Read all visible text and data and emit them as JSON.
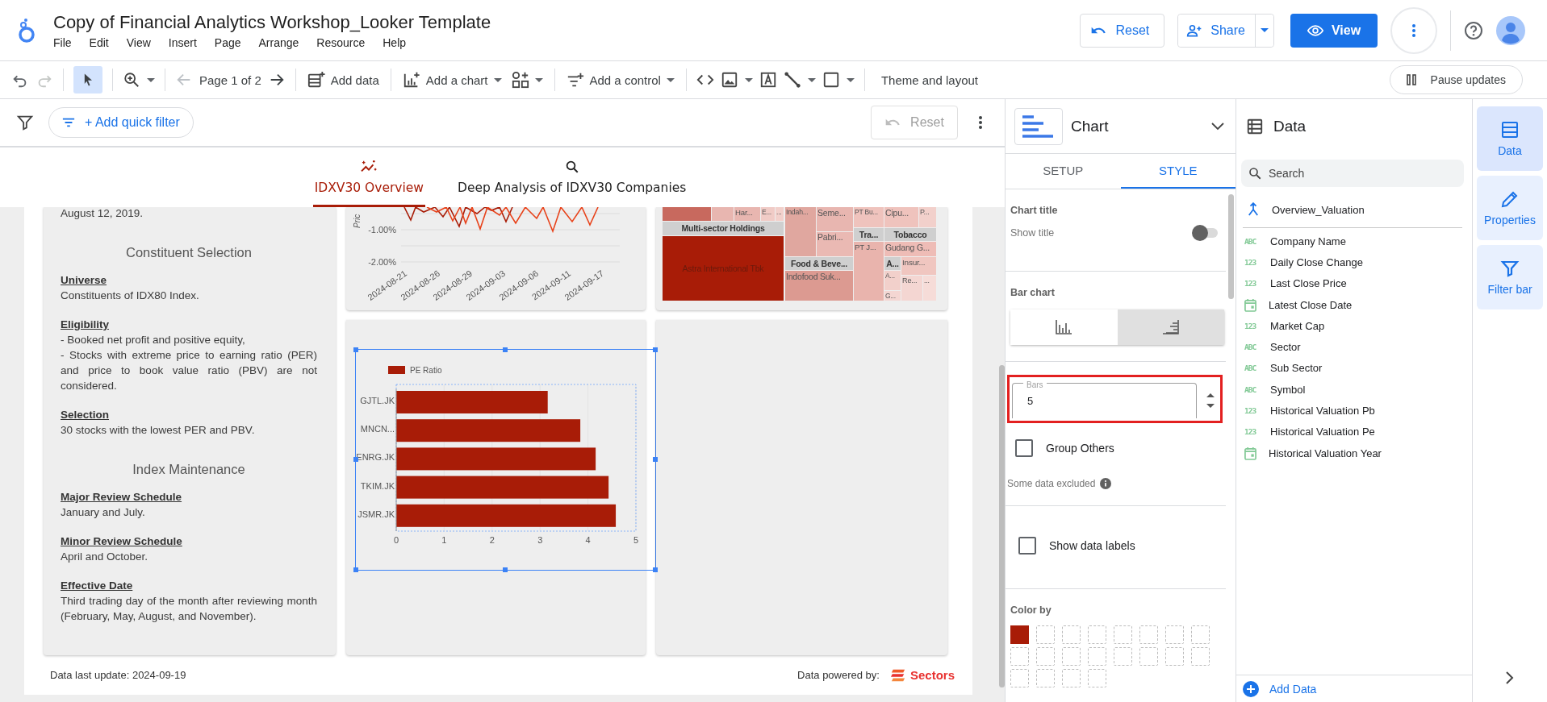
{
  "app": {
    "title": "Copy of Financial Analytics Workshop_Looker Template",
    "menu": [
      "File",
      "Edit",
      "View",
      "Insert",
      "Page",
      "Arrange",
      "Resource",
      "Help"
    ],
    "reset": "Reset",
    "share": "Share",
    "view": "View"
  },
  "toolbar": {
    "page_indicator": "Page 1 of 2",
    "add_data": "Add data",
    "add_chart": "Add a chart",
    "add_control": "Add a control",
    "theme": "Theme and layout",
    "pause": "Pause updates"
  },
  "filter_bar": {
    "add_filter": "+ Add quick filter",
    "reset": "Reset",
    "reset_disabled": true
  },
  "page_tabs": [
    {
      "label": "IDXV30 Overview",
      "selected": true
    },
    {
      "label": "Deep Analysis of IDXV30 Companies",
      "selected": false
    }
  ],
  "description_card": {
    "intro": "August 12, 2019.",
    "blocks": [
      {
        "kind": "heading",
        "text": "Constituent Selection"
      },
      {
        "kind": "item",
        "title": "Universe",
        "lines": [
          "Constituents of IDX80 Index."
        ]
      },
      {
        "kind": "item",
        "title": "Eligibility",
        "lines": [
          "- Booked net profit and positive equity,",
          "- Stocks with extreme price to earning ratio (PER) and price to book value ratio (PBV) are not considered."
        ]
      },
      {
        "kind": "item",
        "title": "Selection",
        "lines": [
          "30 stocks with the lowest PER and PBV."
        ]
      },
      {
        "kind": "heading",
        "text": "Index Maintenance"
      },
      {
        "kind": "item",
        "title": "Major Review Schedule",
        "lines": [
          "January and July."
        ]
      },
      {
        "kind": "item",
        "title": "Minor Review Schedule",
        "lines": [
          "April and October."
        ]
      },
      {
        "kind": "item",
        "title": "Effective Date",
        "lines": [
          "Third trading day of the month after reviewing month (February, May, August, and November)."
        ]
      }
    ]
  },
  "price_chart": {
    "y_axis_label": "Pric",
    "y_ticks": [
      "-1.00%",
      "-2.00%"
    ],
    "x_ticks": [
      "2024-08-21",
      "2024-08-26",
      "2024-08-29",
      "2024-09-03",
      "2024-09-06",
      "2024-09-11",
      "2024-09-17"
    ]
  },
  "treemap": {
    "cells": [
      {
        "kind": "cell",
        "color": "#c8695e"
      },
      {
        "kind": "cell",
        "color": "#e8b6b0"
      },
      {
        "kind": "cell",
        "label": "Har...",
        "color": "#e8b6b0"
      },
      {
        "kind": "cell",
        "label": "E...",
        "color": "#f0cbc6"
      },
      {
        "kind": "cell",
        "label": "...",
        "color": "#f2d0cb"
      },
      {
        "kind": "header",
        "label": "Multi-sector Holdings"
      },
      {
        "kind": "cell",
        "label": "Astra International Tbk",
        "color": "#a81c07"
      },
      {
        "kind": "cell",
        "label": "Indah...",
        "color": "#e0a79f"
      },
      {
        "kind": "cell",
        "label": "Seme...",
        "color": "#e8b6b0"
      },
      {
        "kind": "cell",
        "label": "Pabri...",
        "color": "#eab9b3"
      },
      {
        "kind": "header",
        "label": "Food & Beve..."
      },
      {
        "kind": "cell",
        "label": "Indofood Suk...",
        "color": "#dc9a91"
      },
      {
        "kind": "cell",
        "label": "PT Bu...",
        "color": "#efc3bd"
      },
      {
        "kind": "header",
        "label": "Tra..."
      },
      {
        "kind": "cell",
        "label": "PT J...",
        "color": "#e9b4ad"
      },
      {
        "kind": "cell",
        "label": "Cipu...",
        "color": "#efc3bd"
      },
      {
        "kind": "cell",
        "label": "P...",
        "color": "#f2d0cb"
      },
      {
        "kind": "header",
        "label": "Tobacco"
      },
      {
        "kind": "cell",
        "label": "Gudang G...",
        "color": "#eebcb6"
      },
      {
        "kind": "header",
        "label": "A..."
      },
      {
        "kind": "cell",
        "label": "A...",
        "color": "#f2d0cb"
      },
      {
        "kind": "cell",
        "label": "G...",
        "color": "#f4d6d2"
      },
      {
        "kind": "cell",
        "label": "Insur...",
        "color": "#f0c6c0"
      },
      {
        "kind": "cell",
        "label": "Re...",
        "color": "#f4d6d2"
      },
      {
        "kind": "cell",
        "label": "...",
        "color": "#f6dcd8"
      }
    ]
  },
  "pe_chart": {
    "chart_data": {
      "type": "bar",
      "orientation": "horizontal",
      "categories": [
        "GJTL.JK",
        "MNCN...",
        "ENRG.JK",
        "TKIM.JK",
        "JSMR.JK"
      ],
      "series": [
        {
          "name": "PE Ratio",
          "color": "#a81c07",
          "values": [
            3.16,
            3.84,
            4.16,
            4.43,
            4.58
          ]
        }
      ],
      "xlim": [
        0,
        5
      ],
      "xticks": [
        0,
        1,
        2,
        3,
        4,
        5
      ],
      "grid": true
    }
  },
  "footer": {
    "updated": "Data last update: 2024-09-19",
    "powered_by": "Data powered by:",
    "brand": "Sectors"
  },
  "chart_panel": {
    "title": "Chart",
    "tabs": [
      {
        "label": "SETUP",
        "selected": false
      },
      {
        "label": "STYLE",
        "selected": true
      }
    ],
    "chart_title_label": "Chart title",
    "show_title_label": "Show title",
    "show_title": false,
    "bar_chart_label": "Bar chart",
    "orientations": [
      {
        "kind": "vertical",
        "selected": false
      },
      {
        "kind": "horizontal",
        "selected": true
      }
    ],
    "bars_label": "Bars",
    "bars_value": "5",
    "group_others_label": "Group Others",
    "group_others": false,
    "excluded_note": "Some data excluded",
    "data_labels_label": "Show data labels",
    "data_labels": false,
    "color_by_label": "Color by",
    "swatches": [
      {
        "color": "#a81c07"
      }
    ]
  },
  "data_panel": {
    "title": "Data",
    "search_placeholder": "Search",
    "source": "Overview_Valuation",
    "fields": [
      {
        "kind": "text",
        "badge": "ABC",
        "name": "Company Name"
      },
      {
        "kind": "number",
        "badge": "123",
        "name": "Daily Close Change"
      },
      {
        "kind": "number",
        "badge": "123",
        "name": "Last Close Price"
      },
      {
        "kind": "date",
        "name": "Latest Close Date"
      },
      {
        "kind": "number",
        "badge": "123",
        "name": "Market Cap"
      },
      {
        "kind": "text",
        "badge": "ABC",
        "name": "Sector"
      },
      {
        "kind": "text",
        "badge": "ABC",
        "name": "Sub Sector"
      },
      {
        "kind": "text",
        "badge": "ABC",
        "name": "Symbol"
      },
      {
        "kind": "number",
        "badge": "123",
        "name": "Historical Valuation Pb"
      },
      {
        "kind": "number",
        "badge": "123",
        "name": "Historical Valuation Pe"
      },
      {
        "kind": "date",
        "name": "Historical Valuation Year"
      }
    ],
    "add_data": "Add Data"
  },
  "rail": [
    {
      "kind": "data",
      "label": "Data",
      "selected": true
    },
    {
      "kind": "properties",
      "label": "Properties",
      "selected": false
    },
    {
      "kind": "filter",
      "label": "Filter bar",
      "selected": false
    }
  ]
}
